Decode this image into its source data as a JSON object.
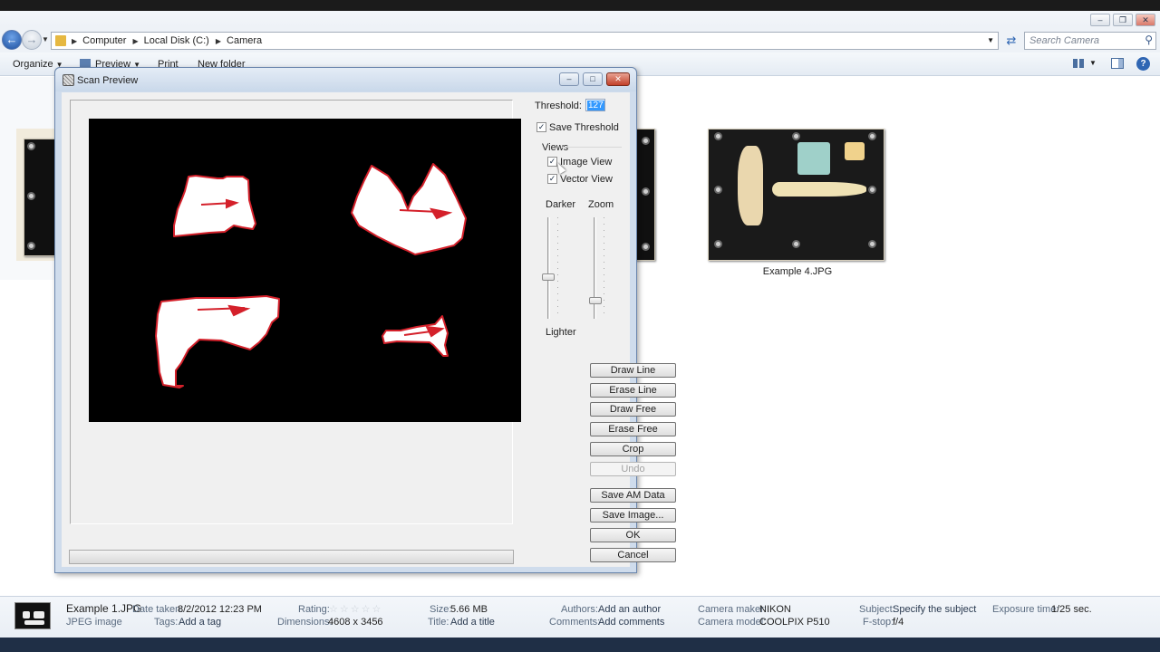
{
  "explorer": {
    "breadcrumb": [
      "Computer",
      "Local Disk (C:)",
      "Camera"
    ],
    "search_placeholder": "Search Camera",
    "toolbar": {
      "organize": "Organize",
      "preview": "Preview",
      "print": "Print",
      "new_folder": "New folder"
    },
    "files": [
      {
        "name": "Example 4.JPG"
      }
    ]
  },
  "details": {
    "file_name": "Example 1.JPG",
    "file_type": "JPEG image",
    "date_taken_label": "Date taken:",
    "date_taken": "8/2/2012 12:23 PM",
    "tags_label": "Tags:",
    "tags": "Add a tag",
    "rating_label": "Rating:",
    "rating": 0,
    "dimensions_label": "Dimensions:",
    "dimensions": "4608 x 3456",
    "size_label": "Size:",
    "size": "5.66 MB",
    "title_label": "Title:",
    "title": "Add a title",
    "authors_label": "Authors:",
    "authors": "Add an author",
    "comments_label": "Comments:",
    "comments": "Add comments",
    "camera_maker_label": "Camera maker:",
    "camera_maker": "NIKON",
    "camera_model_label": "Camera model:",
    "camera_model": "COOLPIX P510",
    "subject_label": "Subject:",
    "subject": "Specify the subject",
    "fstop_label": "F-stop:",
    "fstop": "f/4",
    "exposure_label": "Exposure time:",
    "exposure": "1/25 sec."
  },
  "dialog": {
    "title": "Scan Preview",
    "threshold_label": "Threshold:",
    "threshold_value": "127",
    "save_threshold_label": "Save Threshold",
    "save_threshold_checked": true,
    "views_label": "Views",
    "image_view_label": "Image View",
    "image_view_checked": true,
    "vector_view_label": "Vector View",
    "vector_view_checked": true,
    "darker_label": "Darker",
    "lighter_label": "Lighter",
    "zoom_label": "Zoom",
    "darker_lighter_level": 0.4,
    "zoom_level": 0.15,
    "buttons": {
      "draw_line": "Draw Line",
      "erase_line": "Erase Line",
      "draw_free": "Draw Free",
      "erase_free": "Erase Free",
      "crop": "Crop",
      "undo": "Undo",
      "save_am_data": "Save AM Data",
      "save_image": "Save Image...",
      "ok": "OK",
      "cancel": "Cancel"
    }
  },
  "colors": {
    "outline": "#d4202a",
    "shape_fill": "#ffffff",
    "canvas_bg": "#000000",
    "accent": "#3399ff"
  }
}
